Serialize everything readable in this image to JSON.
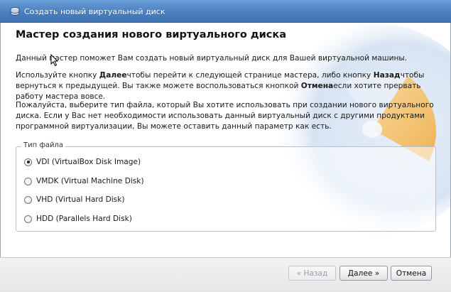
{
  "window": {
    "title": "Создать новый виртуальный диск",
    "icon": "virtual-disk-icon"
  },
  "page": {
    "heading": "Мастер создания нового виртуального диска",
    "intro": "Данный мастер поможет Вам создать новый виртуальный диск для Вашей виртуальной машины.",
    "nav_text": {
      "part1": "Используйте кнопку ",
      "next_word": "Далее",
      "part2": "чтобы перейти к следующей странице мастера, либо кнопку ",
      "back_word": "Назад",
      "part3": "чтобы вернуться к предыдущей. Вы также можете воспользоваться кнопкой ",
      "cancel_word": "Отмена",
      "part4": "если хотите прервать работу мастера вовсе."
    },
    "choose_text": "Пожалуйста, выберите тип файла, который Вы хотите использовать при создании нового виртуального диска. Если у Вас нет необходимости использовать данный виртуальный диск с другими продуктами программной виртуализации, Вы можете оставить данный параметр как есть."
  },
  "file_type": {
    "label": "Тип файла",
    "options": [
      {
        "label": "VDI (VirtualBox Disk Image)",
        "checked": true
      },
      {
        "label": "VMDK (Virtual Machine Disk)",
        "checked": false
      },
      {
        "label": "VHD (Virtual Hard Disk)",
        "checked": false
      },
      {
        "label": "HDD (Parallels Hard Disk)",
        "checked": false
      }
    ]
  },
  "buttons": {
    "back": "« Назад",
    "next": "Далее »",
    "cancel": "Отмена"
  },
  "colors": {
    "titlebar": "#4b7fc0",
    "art_orange": "#f5b14a",
    "art_blue": "#cfe0f3"
  }
}
